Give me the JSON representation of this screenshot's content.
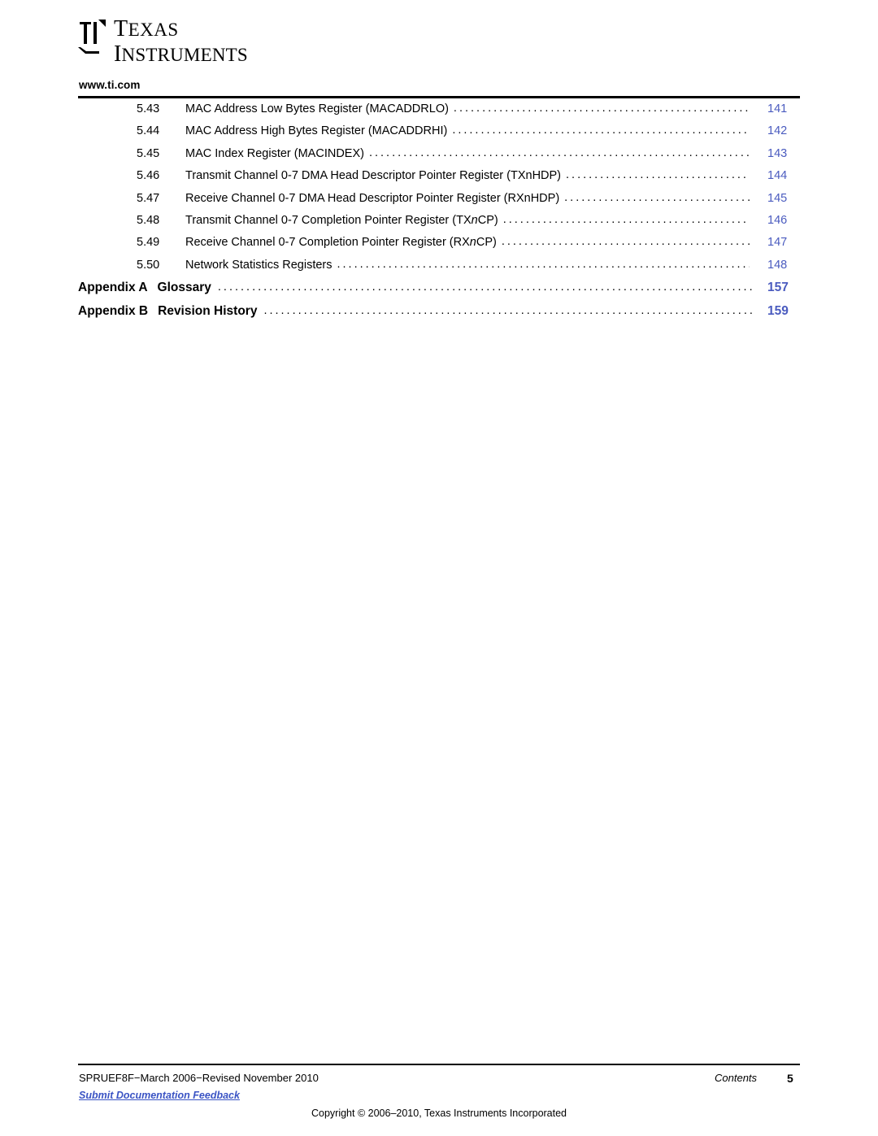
{
  "header": {
    "logo_line1": "TEXAS",
    "logo_line2": "INSTRUMENTS",
    "url": "www.ti.com"
  },
  "toc": {
    "rows": [
      {
        "num": "5.43",
        "title": "MAC Address Low Bytes Register (MACADDRLO)",
        "page": "141"
      },
      {
        "num": "5.44",
        "title": "MAC Address High Bytes Register (MACADDRHI)",
        "page": "142"
      },
      {
        "num": "5.45",
        "title": "MAC Index Register (MACINDEX)",
        "page": "143"
      },
      {
        "num": "5.46",
        "title": "Transmit Channel 0-7 DMA Head Descriptor Pointer Register (TXnHDP)",
        "page": "144"
      },
      {
        "num": "5.47",
        "title": "Receive Channel 0-7 DMA Head Descriptor Pointer Register (RXnHDP)",
        "page": "145"
      },
      {
        "num": "5.48",
        "title": "Transmit Channel 0-7 Completion Pointer Register (TXnCP)",
        "page": "146"
      },
      {
        "num": "5.49",
        "title": "Receive Channel 0-7 Completion Pointer Register (RXnCP)",
        "page": "147"
      },
      {
        "num": "5.50",
        "title": "Network Statistics Registers",
        "page": "148"
      }
    ],
    "appendices": [
      {
        "label": "Appendix A",
        "title": "Glossary",
        "page": "157"
      },
      {
        "label": "Appendix B",
        "title": "Revision History",
        "page": "159"
      }
    ]
  },
  "footer": {
    "document_id": "SPRUEF8F−March 2006−Revised November 2010",
    "section": "Contents",
    "page_number": "5",
    "feedback_link": "Submit Documentation Feedback",
    "copyright": "Copyright © 2006–2010, Texas Instruments Incorporated"
  }
}
